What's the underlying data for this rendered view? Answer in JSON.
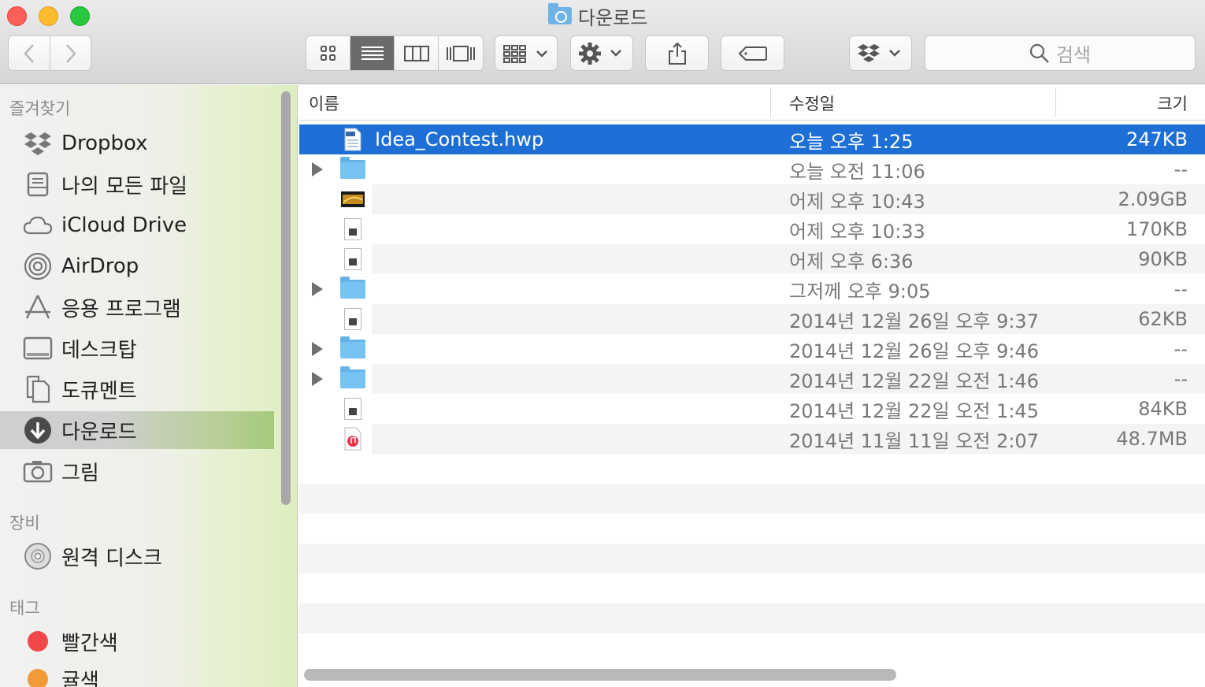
{
  "window": {
    "title": "다운로드"
  },
  "toolbar": {
    "back_icon": "chevron-left-icon",
    "forward_icon": "chevron-right-icon",
    "view_modes": [
      "icon-view-icon",
      "list-view-icon",
      "column-view-icon",
      "coverflow-view-icon"
    ],
    "active_view": "list-view-icon",
    "search_placeholder": "검색"
  },
  "sidebar": {
    "sections": {
      "favorites": "즐겨찾기",
      "devices": "장비",
      "tags": "태그"
    },
    "favorites": [
      {
        "label": "Dropbox",
        "icon": "dropbox-icon"
      },
      {
        "label": "나의 모든 파일",
        "icon": "all-files-icon"
      },
      {
        "label": "iCloud Drive",
        "icon": "cloud-icon"
      },
      {
        "label": "AirDrop",
        "icon": "airdrop-icon"
      },
      {
        "label": "응용 프로그램",
        "icon": "applications-icon"
      },
      {
        "label": "데스크탑",
        "icon": "desktop-icon"
      },
      {
        "label": "도큐멘트",
        "icon": "documents-icon"
      },
      {
        "label": "다운로드",
        "icon": "downloads-icon",
        "selected": true
      },
      {
        "label": "그림",
        "icon": "camera-icon"
      }
    ],
    "devices": [
      {
        "label": "원격 디스크",
        "icon": "remote-disc-icon"
      }
    ],
    "tags": [
      {
        "label": "빨간색",
        "color": "#f0474a"
      },
      {
        "label": "귤색",
        "color": "#f39a38"
      }
    ]
  },
  "list": {
    "columns": {
      "name": "이름",
      "date": "수정일",
      "size": "크기"
    },
    "rows": [
      {
        "name": "Idea_Contest.hwp",
        "date": "오늘 오후 1:25",
        "size": "247KB",
        "kind": "hwp",
        "selected": true
      },
      {
        "name": "",
        "date": "오늘 오전 11:06",
        "size": "--",
        "kind": "folder"
      },
      {
        "name": "",
        "date": "어제 오후 10:43",
        "size": "2.09GB",
        "kind": "video"
      },
      {
        "name": "",
        "date": "어제 오후 10:33",
        "size": "170KB",
        "kind": "doc"
      },
      {
        "name": "",
        "date": "어제 오후 6:36",
        "size": "90KB",
        "kind": "doc"
      },
      {
        "name": "",
        "date": "그저께 오후 9:05",
        "size": "--",
        "kind": "folder"
      },
      {
        "name": "",
        "date": "2014년 12월 26일 오후 9:37",
        "size": "62KB",
        "kind": "doc"
      },
      {
        "name": "",
        "date": "2014년 12월 26일 오후 9:46",
        "size": "--",
        "kind": "folder"
      },
      {
        "name": "",
        "date": "2014년 12월 22일 오전 1:46",
        "size": "--",
        "kind": "folder"
      },
      {
        "name": "",
        "date": "2014년 12월 22일 오전 1:45",
        "size": "84KB",
        "kind": "doc"
      },
      {
        "name": "",
        "date": "2014년 11월 11일 오전 2:07",
        "size": "48.7MB",
        "kind": "audio"
      }
    ]
  }
}
